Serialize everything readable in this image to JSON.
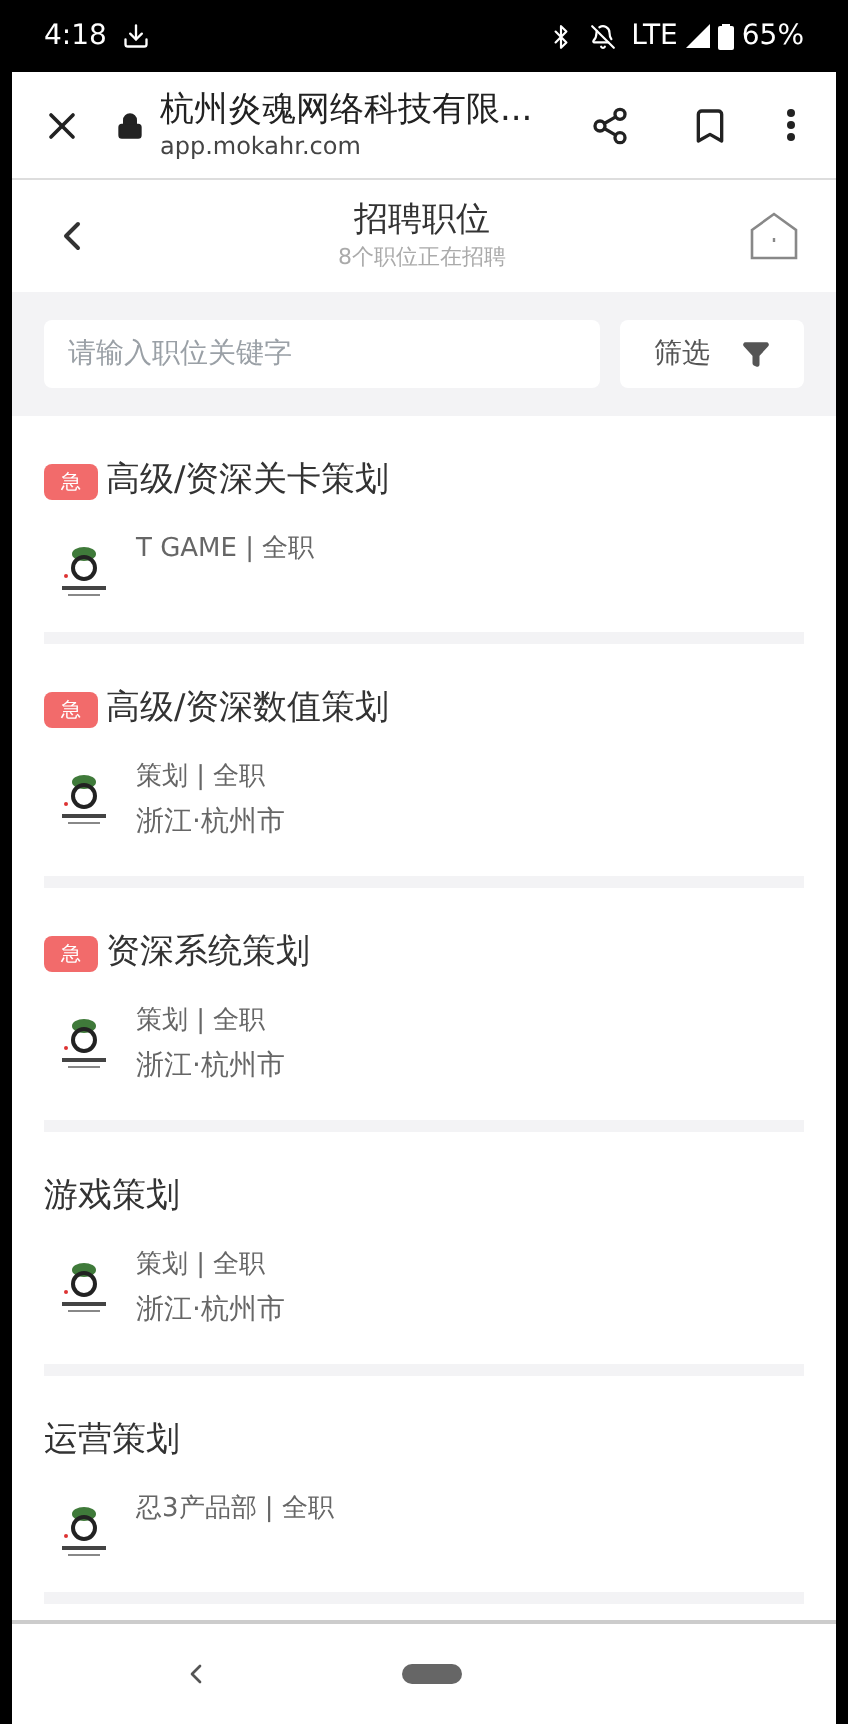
{
  "status_bar": {
    "time": "4:18",
    "network": "LTE",
    "battery": "65%"
  },
  "browser": {
    "title": "杭州炎魂网络科技有限...",
    "url": "app.mokahr.com"
  },
  "header": {
    "title": "招聘职位",
    "subtitle": "8个职位正在招聘"
  },
  "search": {
    "placeholder": "请输入职位关键字"
  },
  "filter": {
    "label": "筛选"
  },
  "jobs": [
    {
      "badge": "急",
      "title": "高级/资深关卡策划",
      "meta": [
        "T GAME | 全职"
      ]
    },
    {
      "badge": "急",
      "title": "高级/资深数值策划",
      "meta": [
        "策划 | 全职",
        "浙江·杭州市"
      ]
    },
    {
      "badge": "急",
      "title": "资深系统策划",
      "meta": [
        "策划 | 全职",
        "浙江·杭州市"
      ]
    },
    {
      "title": "游戏策划",
      "meta": [
        "策划 | 全职",
        "浙江·杭州市"
      ]
    },
    {
      "title": "运营策划",
      "meta": [
        "忍3产品部 | 全职"
      ]
    }
  ]
}
